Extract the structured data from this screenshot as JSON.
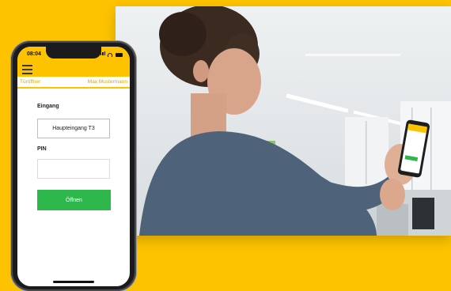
{
  "phone": {
    "status_time": "08:04",
    "nav_left": "Türöffner",
    "nav_right": "Max Mustermann",
    "entrance_label": "Eingang",
    "entrance_value": "Haupteingang T3",
    "pin_label": "PIN",
    "pin_value": "",
    "open_button_label": "Öffnen"
  },
  "colors": {
    "brand_yellow": "#fdc300",
    "button_green": "#2eb84b"
  },
  "photo": {
    "subject": "woman-holding-phone"
  }
}
